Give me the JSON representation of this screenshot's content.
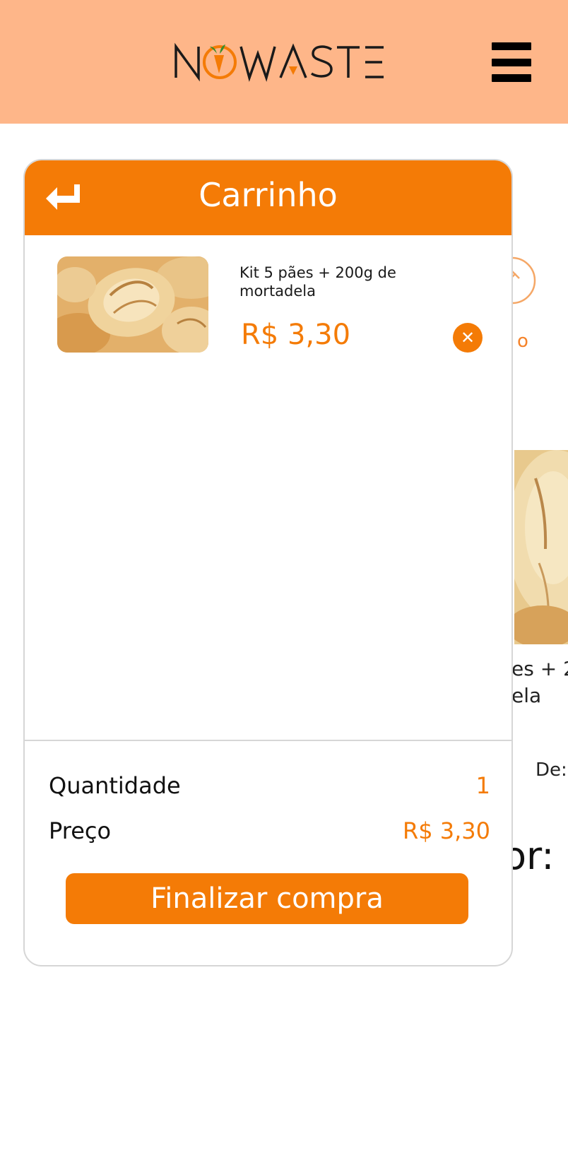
{
  "header": {
    "logo_text": "NOWASTE",
    "brand_color": "#feb689",
    "menu_icon": "hamburger-menu-icon"
  },
  "background": {
    "partial_text_1": "es + 2",
    "partial_text_2": "ela",
    "partial_text_3": "De:",
    "partial_text_4": "or:",
    "partial_letter": "o"
  },
  "cart": {
    "title": "Carrinho",
    "back_icon": "return-arrow-icon",
    "accent_color": "#f47b06",
    "items": [
      {
        "name": "Kit 5 pães + 200g de mortadela",
        "price": "R$ 3,30",
        "image": "bread-rolls-image",
        "remove_icon": "close-icon"
      }
    ],
    "summary": {
      "quantity_label": "Quantidade",
      "quantity_value": "1",
      "price_label": "Preço",
      "price_value": "R$ 3,30"
    },
    "checkout_label": "Finalizar compra"
  }
}
